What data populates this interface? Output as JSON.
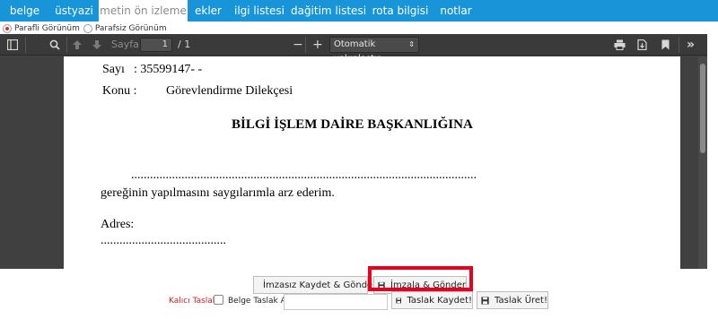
{
  "tabs": [
    {
      "label": "belge",
      "active": false
    },
    {
      "label": "üstyazi",
      "active": false
    },
    {
      "label": "metin ön izleme",
      "active": true
    },
    {
      "label": "ekler",
      "active": false
    },
    {
      "label": "ilgi listesi",
      "active": false
    },
    {
      "label": "dağitim listesi",
      "active": false
    },
    {
      "label": "rota bilgisi",
      "active": false
    },
    {
      "label": "notlar",
      "active": false
    }
  ],
  "view_mode": {
    "paraf_label": "Parafli Görünüm",
    "parafsiz_label": "Parafsiz Görünüm",
    "selected": "paraf"
  },
  "pdf_toolbar": {
    "page_label": "Sayfa:",
    "page_value": "1",
    "page_total": "/ 1",
    "zoom_value": "Otomatik yakınlaştır",
    "zoom_minus": "−",
    "zoom_plus": "+"
  },
  "document": {
    "sayi_label": "Sayı",
    "sayi_value": ": 35599147- -",
    "konu_label": "Konu :",
    "konu_value": "Görevlendirme Dilekçesi",
    "heading": "BİLGİ İŞLEM DAİRE BAŞKANLIĞINA",
    "dotted_line": "..............................................................................................................",
    "body_line": "gereğinin yapılmasını saygılarımla arz ederim.",
    "adres_label": "Adres:",
    "adres_dots": "........................................"
  },
  "actions": {
    "imzasiz_label": "İmzasız Kaydet & Gönder",
    "imzala_label": "İmzala & Gönder",
    "kalici_taslak_label": "Kalıcı Taslak",
    "belge_taslak_adi_label": "Belge Taslak Adı",
    "belge_taslak_adi_value": "",
    "taslak_kaydet_label": "Taslak Kaydet!",
    "taslak_uret_label": "Taslak Üret!"
  },
  "colors": {
    "tab_bar": "#1795d8",
    "highlight": "#e8001c",
    "kalici_taslak_text": "#cc1f1f"
  }
}
